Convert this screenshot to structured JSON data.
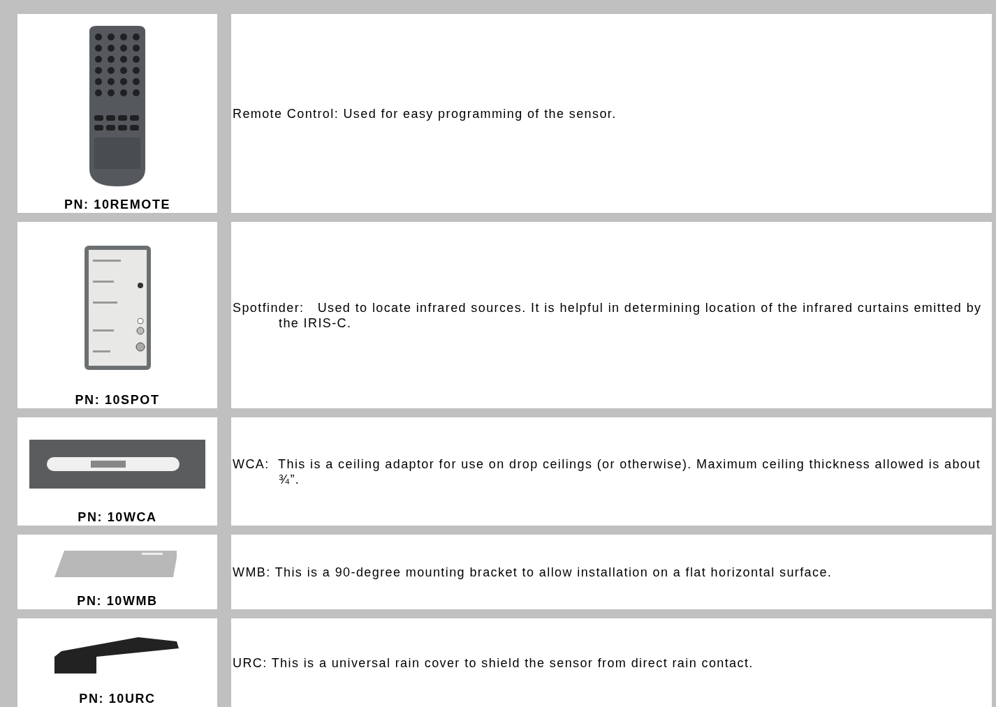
{
  "accessories": [
    {
      "kind": "remote",
      "part_number": "PN: 10REMOTE",
      "description": "Remote Control: Used for easy programming of the sensor."
    },
    {
      "kind": "spotfinder",
      "part_number": "PN: 10SPOT",
      "description": "Spotfinder:   Used to locate infrared sources. It is helpful in determining location of the infrared curtains emitted by the IRIS-C."
    },
    {
      "kind": "adaptor",
      "part_number": "PN: 10WCA",
      "description": "WCA:  This is a ceiling adaptor for use on drop ceilings (or otherwise). Maximum ceiling thickness allowed is about ¾”."
    },
    {
      "kind": "bracket",
      "part_number": "PN: 10WMB",
      "description": "WMB: This is a 90-degree mounting bracket to allow installation on a flat horizontal surface."
    },
    {
      "kind": "cover",
      "part_number": "PN: 10URC",
      "description": "URC: This is a universal rain cover to shield the sensor from direct rain contact."
    }
  ]
}
